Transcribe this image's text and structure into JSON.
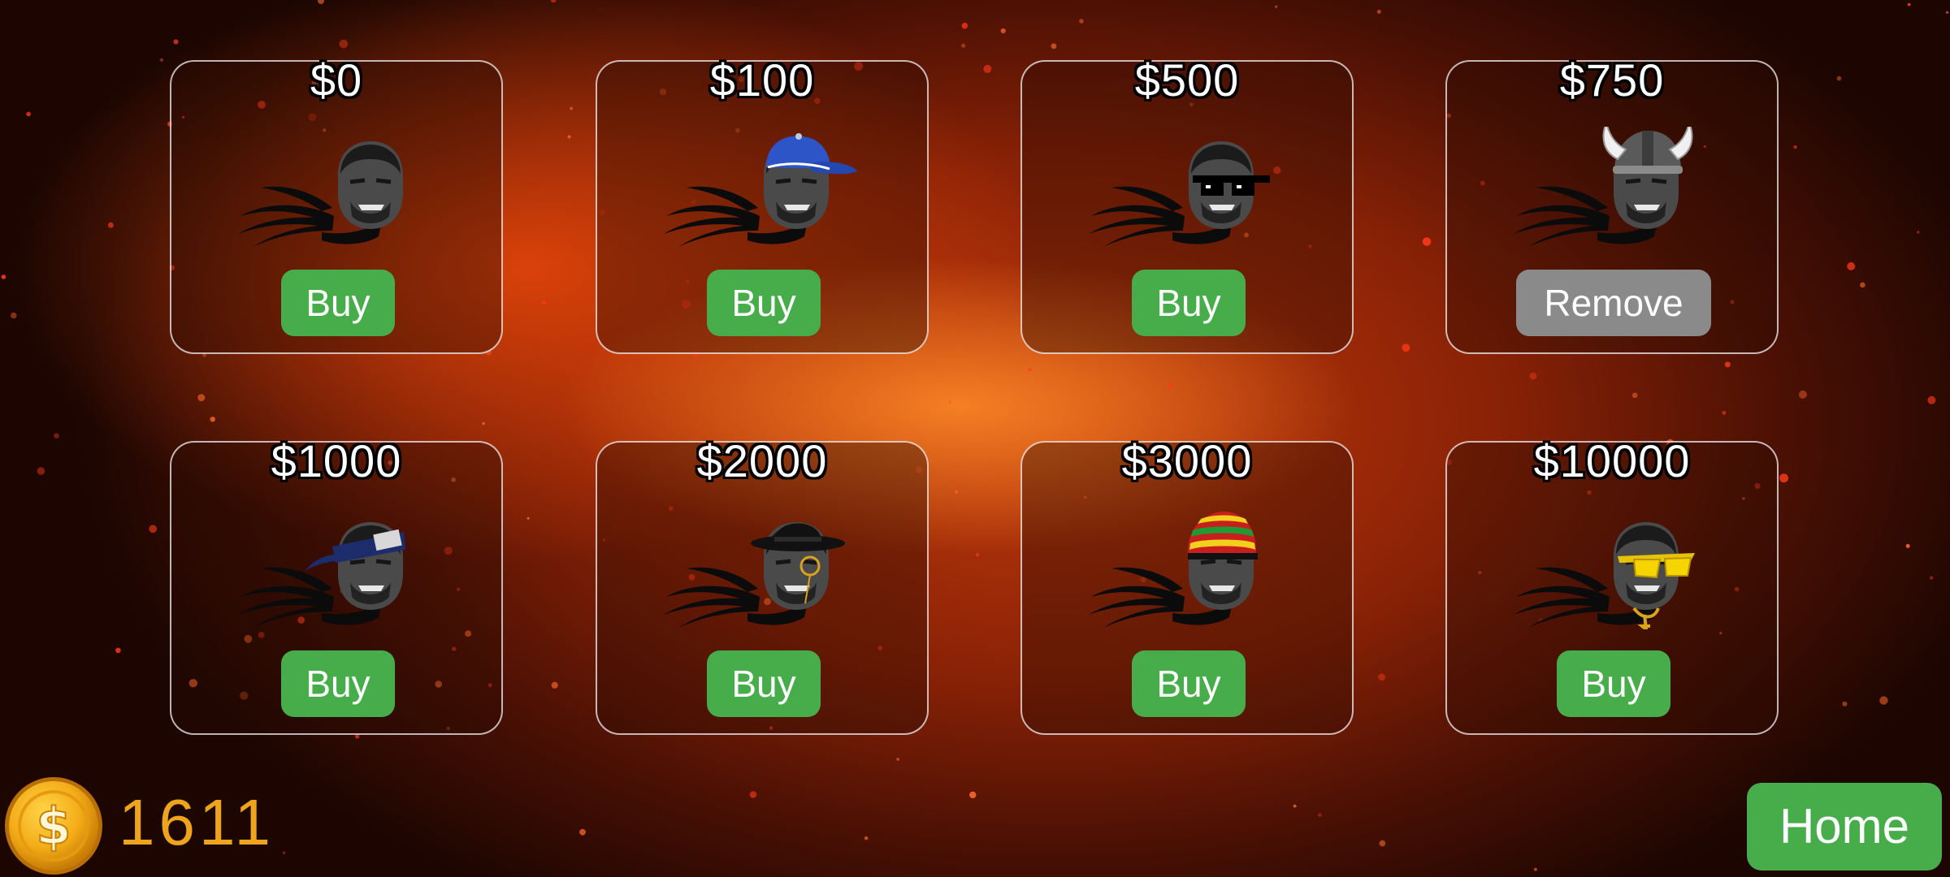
{
  "shop": {
    "items": [
      {
        "price": "$0",
        "button": "Buy",
        "state": "buy",
        "accessory": "none"
      },
      {
        "price": "$100",
        "button": "Buy",
        "state": "buy",
        "accessory": "blue-cap"
      },
      {
        "price": "$500",
        "button": "Buy",
        "state": "buy",
        "accessory": "pixel-sunglasses"
      },
      {
        "price": "$750",
        "button": "Remove",
        "state": "equipped",
        "accessory": "viking-helmet"
      },
      {
        "price": "$1000",
        "button": "Buy",
        "state": "buy",
        "accessory": "ninja-headband"
      },
      {
        "price": "$2000",
        "button": "Buy",
        "state": "buy",
        "accessory": "bowler-hat-monocle"
      },
      {
        "price": "$3000",
        "button": "Buy",
        "state": "buy",
        "accessory": "rasta-beanie"
      },
      {
        "price": "$10000",
        "button": "Buy",
        "state": "buy",
        "accessory": "gold-shades-chain"
      }
    ]
  },
  "wallet": {
    "coins": "1611",
    "icon": "dollar-coin-icon"
  },
  "nav": {
    "home_label": "Home"
  },
  "colors": {
    "buy_button": "#46ad4a",
    "remove_button": "#8a8a8a",
    "coin_text": "#f0a41e"
  }
}
